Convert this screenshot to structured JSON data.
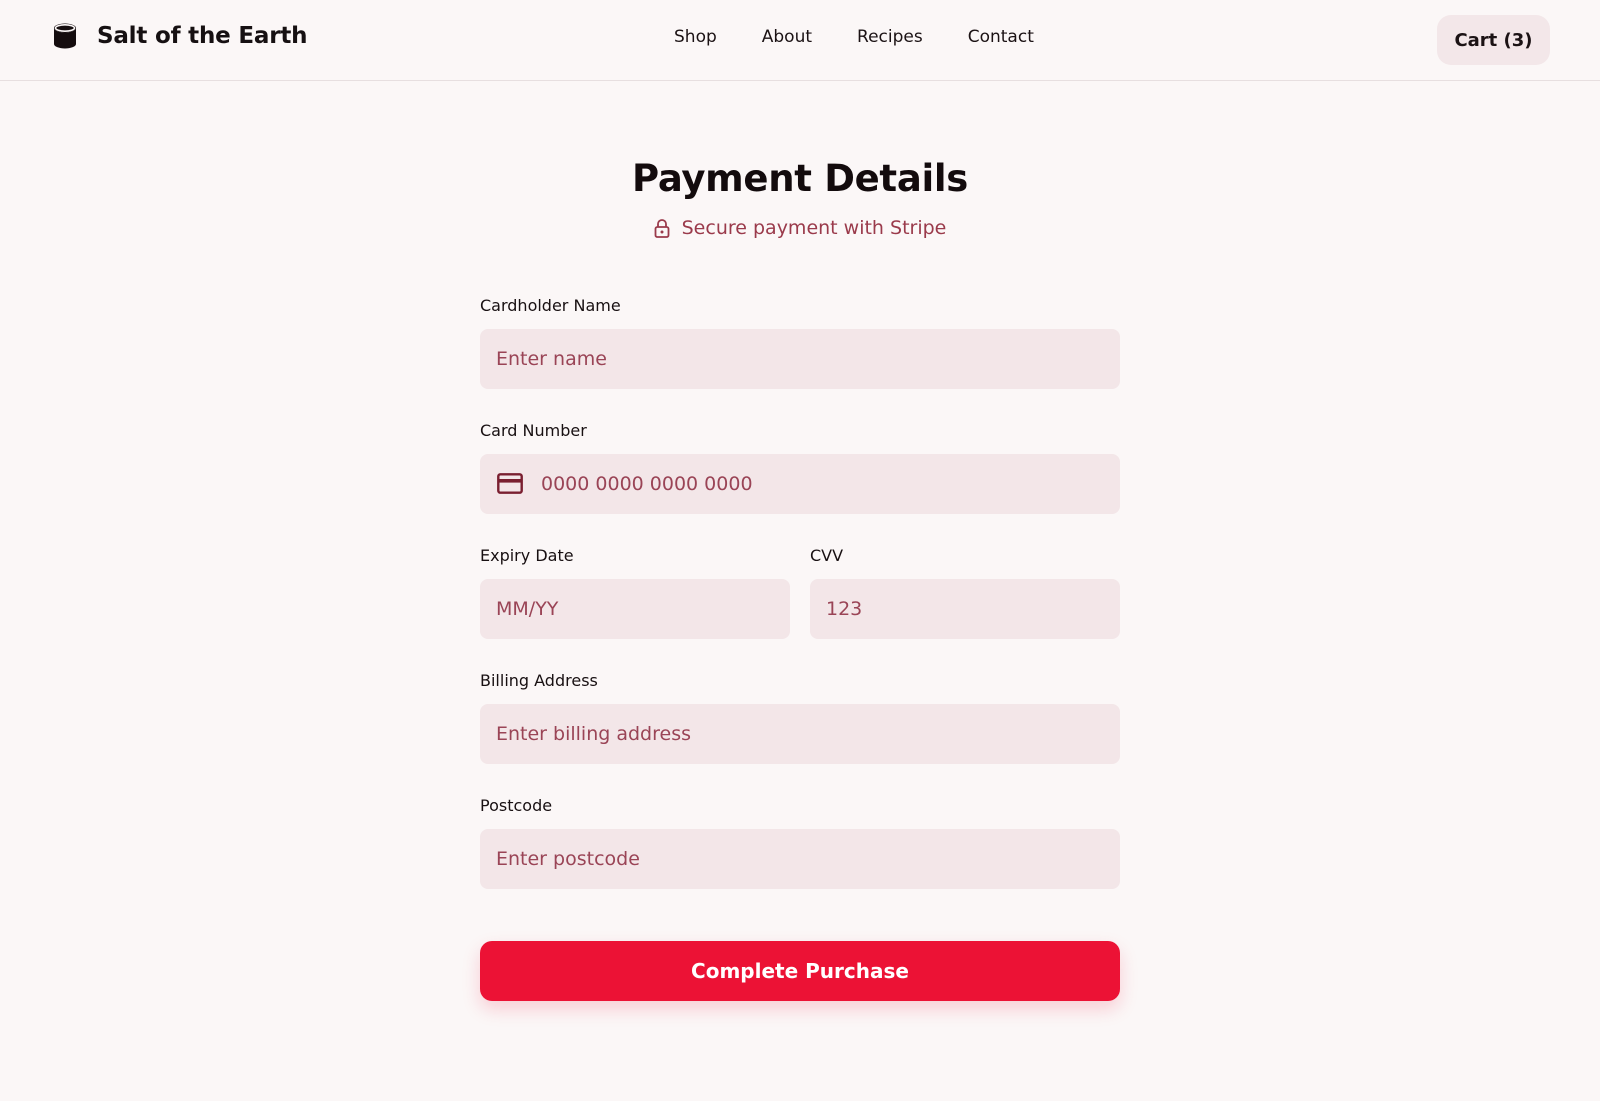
{
  "brand": {
    "name": "Salt of the Earth",
    "icon": "salt-jar-icon"
  },
  "nav": {
    "items": [
      "Shop",
      "About",
      "Recipes",
      "Contact"
    ]
  },
  "cart": {
    "label": "Cart (3)"
  },
  "form": {
    "title": "Payment Details",
    "secure_text": "Secure payment with Stripe",
    "secure_icon": "lock-icon",
    "fields": {
      "cardholder": {
        "label": "Cardholder Name",
        "placeholder": "Enter name",
        "value": ""
      },
      "card_number": {
        "label": "Card Number",
        "placeholder": "0000 0000 0000 0000",
        "value": "",
        "icon": "credit-card-icon"
      },
      "expiry": {
        "label": "Expiry Date",
        "placeholder": "MM/YY",
        "value": ""
      },
      "cvv": {
        "label": "CVV",
        "placeholder": "123",
        "value": ""
      },
      "billing_address": {
        "label": "Billing Address",
        "placeholder": "Enter billing address",
        "value": ""
      },
      "postcode": {
        "label": "Postcode",
        "placeholder": "Enter postcode",
        "value": ""
      }
    },
    "submit_label": "Complete Purchase"
  },
  "colors": {
    "background": "#fbf7f7",
    "input_background": "#f3e6e8",
    "accent": "#ec1235",
    "muted_text": "#9a3a4b"
  }
}
